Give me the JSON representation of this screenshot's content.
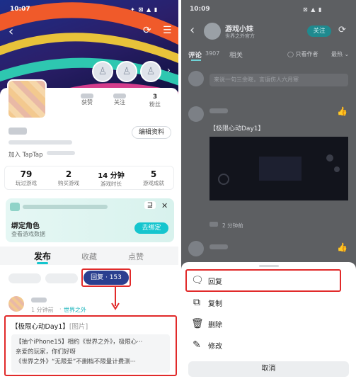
{
  "left": {
    "status_time": "10:07",
    "status_icons": "✦ ⊠ ▲ ▮",
    "back_icon": "‹",
    "share_icon": "⟳",
    "menu_icon": "☰",
    "stats": [
      {
        "num": "",
        "label": "获赞"
      },
      {
        "num": "",
        "label": "关注"
      },
      {
        "num": "3",
        "label": "粉丝"
      }
    ],
    "edit_profile": "编辑资料",
    "join_text": "加入 TapTap",
    "numbers": [
      {
        "num": "79",
        "label": "玩过游戏"
      },
      {
        "num": "2",
        "label": "购买游戏"
      },
      {
        "num": "14 分钟",
        "label": "游戏时长"
      },
      {
        "num": "5",
        "label": "游戏成就"
      }
    ],
    "bind_card": {
      "title": "绑定角色",
      "subtitle": "查看游戏数据",
      "button": "去绑定",
      "icon_left": "⊒",
      "close": "✕"
    },
    "tabs": [
      "发布",
      "收藏",
      "点赞"
    ],
    "reply_chip": "回复 · 153",
    "comment": {
      "meta_time": "1 分钟前",
      "meta_game": "世界之外",
      "title": "【极限心动Day1】",
      "title_tag": "[图片]",
      "quote_line1": "【抽个iPhone15】相约《世界之外》，极限心···",
      "quote_line2": "亲爱的玩家，你们好呀",
      "quote_line3": "《世界之外》“无限爱”不删档不限量计费测···"
    }
  },
  "right": {
    "status_time": "10:09",
    "status_icons": "⊠ ▲ ▮",
    "username": "游戏小妹",
    "user_sub": "世界之外官方",
    "follow": "关注",
    "tab_comment": "评论",
    "tab_comment_count": "3907",
    "tab_related": "相关",
    "only_author": "只看作者",
    "sort": "最热",
    "input_placeholder": "来说一句三余晓，言语伤人六月寒",
    "post_title": "【极限心动Day1】",
    "time_ago": "2 分钟前",
    "sheet": {
      "items": [
        {
          "label": "回复",
          "icon": "chat-icon"
        },
        {
          "label": "复制",
          "icon": "copy-icon"
        },
        {
          "label": "删除",
          "icon": "trash-icon"
        },
        {
          "label": "修改",
          "icon": "edit-icon"
        }
      ],
      "cancel": "取消"
    }
  },
  "colors": {
    "accent": "#15c5ce",
    "chip_blue": "#2a3f8f",
    "highlight_red": "#e12a2a"
  }
}
